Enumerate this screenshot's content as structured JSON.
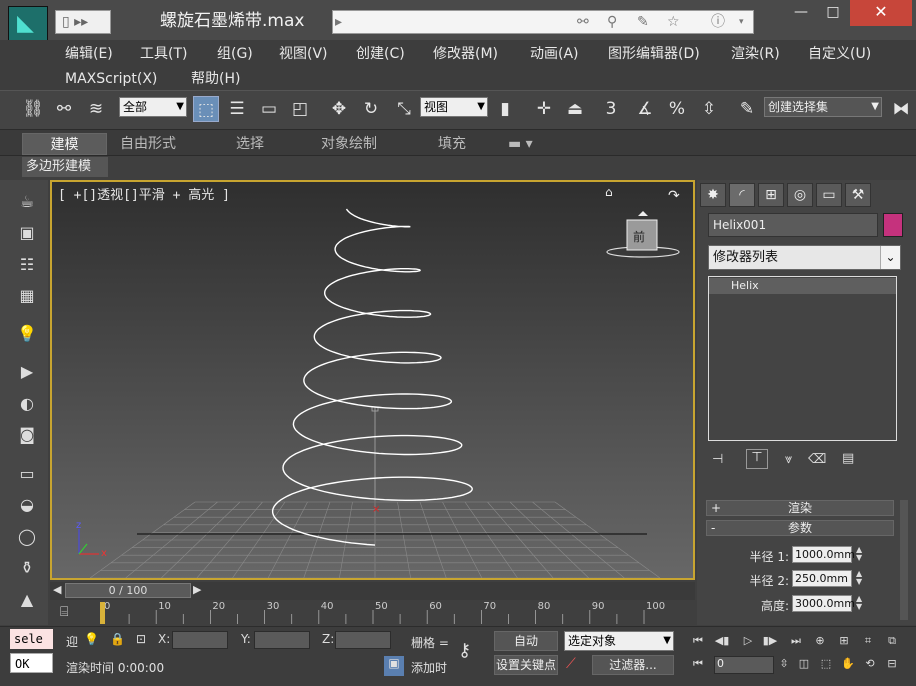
{
  "window": {
    "title": "螺旋石墨烯带.max",
    "min": "—",
    "max": "□",
    "close": "✕"
  },
  "menu": [
    "编辑(E)",
    "工具(T)",
    "组(G)",
    "视图(V)",
    "创建(C)",
    "修改器(M)",
    "动画(A)",
    "图形编辑器(D)",
    "渲染(R)",
    "自定义(U)",
    "MAXScript(X)",
    "帮助(H)"
  ],
  "toolbar": {
    "selection_filter": "全部",
    "ref_coord": "视图",
    "named_selection": "创建选择集",
    "three_label": "3",
    "percent_label": "%"
  },
  "ribbon": {
    "tabs": [
      "建模",
      "自由形式",
      "选择",
      "对象绘制",
      "填充"
    ],
    "sub": "多边形建模"
  },
  "viewport": {
    "label": "[ +[]透视[]平滑 + 高光 ]",
    "viewcube_face": "前",
    "axis_z": "z",
    "axis_x": "x"
  },
  "timeline": {
    "slider": "0 / 100",
    "ticks": [
      "0",
      "10",
      "20",
      "30",
      "40",
      "50",
      "60",
      "70",
      "80",
      "90",
      "100"
    ]
  },
  "command_panel": {
    "object_name": "Helix001",
    "object_color": "#c5327d",
    "modifier_list": "修改器列表",
    "stack_item": "Helix",
    "rollout_render": "渲染",
    "rollout_params": "参数",
    "params": [
      {
        "label": "半径 1:",
        "value": "1000.0mm"
      },
      {
        "label": "半径 2:",
        "value": "250.0mm"
      },
      {
        "label": "高度:",
        "value": "3000.0mm"
      }
    ]
  },
  "status": {
    "maxscript": "sele",
    "ok": "OK",
    "x_label": "X:",
    "y_label": "Y:",
    "z_label": "Z:",
    "grid": "栅格 =",
    "auto": "自动",
    "selected": "选定对象",
    "set_key": "设置关键点",
    "filters": "过滤器...",
    "render_time": "渲染时间 0:00:00",
    "add_time": "添加时",
    "frame": "0",
    "cross_label": "迎"
  }
}
